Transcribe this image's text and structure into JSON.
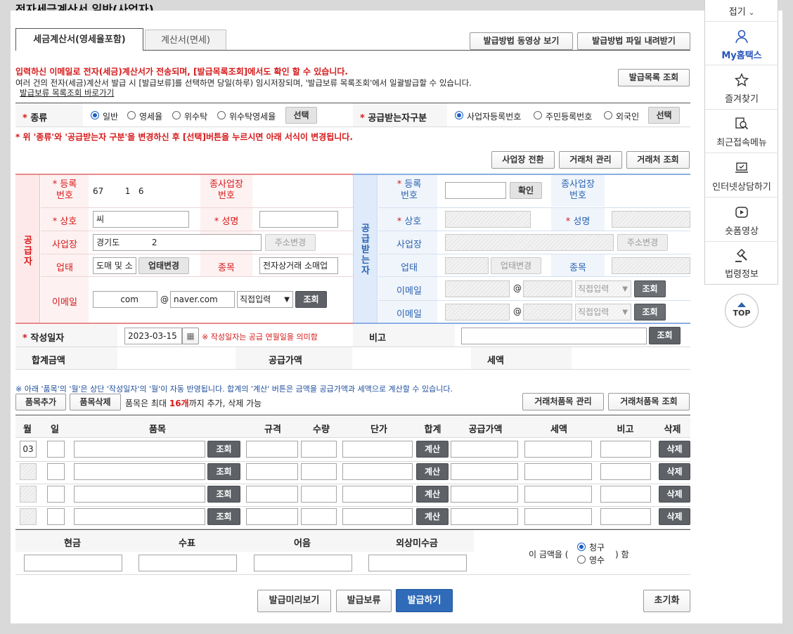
{
  "page": {
    "title": "전자세금계산서 일반(사업자)"
  },
  "tabs": [
    {
      "label": "세금계산서(영세율포함)",
      "active": true
    },
    {
      "label": "계산서(면세)",
      "active": false
    }
  ],
  "top_buttons": {
    "video": "발급방법 동영상 보기",
    "file": "발급방법 파일 내려받기",
    "issue_list": "발급목록 조회"
  },
  "notice": {
    "line1": "입력하신 이메일로 전자(세금)계산서가 전송되며, [발급목록조회]에서도 확인 할 수 있습니다.",
    "line2": "여러 건의 전자(세금)계산서 발급 시 [발급보류]를 선택하면 당일(하루) 임시저장되며, '발급보류 목록조회'에서 일괄발급할 수 있습니다.",
    "hold_link": "발급보류 목록조회 바로가기"
  },
  "type_row": {
    "label": "종류",
    "options": [
      "일반",
      "영세율",
      "위수탁",
      "위수탁영세율"
    ],
    "selected": "일반",
    "select_btn": "선택",
    "recv_label": "공급받는자구분",
    "recv_options": [
      "사업자등록번호",
      "주민등록번호",
      "외국인"
    ],
    "recv_selected": "사업자등록번호",
    "recv_btn": "선택"
  },
  "warn": "* 위 '종류'와 '공급받는자 구분'을 변경하신 후 [선택]버튼을 누르시면 아래 서식이 변경됩니다.",
  "mgmt_buttons": {
    "switch": "사업장 전환",
    "partner_mgmt": "거래처 관리",
    "partner_query": "거래처 조회"
  },
  "supplier": {
    "side": "공급자",
    "reg_label1": "등록",
    "reg_label2": "번호",
    "reg_value": "67        1   6",
    "sub_label1": "종사업장",
    "sub_label2": "번호",
    "name_label": "상호",
    "name_value": "씨",
    "ceo_label": "성명",
    "addr_label": "사업장",
    "addr_value": "경기도            2",
    "addr_btn": "주소변경",
    "biz_label": "업태",
    "biz_value": "도매 및 소",
    "biz_btn": "업태변경",
    "item_label": "종목",
    "item_value": "전자상거래 소매업",
    "email_label": "이메일",
    "email_id": "         com",
    "email_at": "@",
    "email_domain": "naver.com",
    "email_select": "직접입력",
    "email_btn": "조회"
  },
  "buyer": {
    "side": "공급받는자",
    "reg_label1": "등록",
    "reg_label2": "번호",
    "confirm_btn": "확인",
    "sub_label1": "종사업장",
    "sub_label2": "번호",
    "name_label": "상호",
    "ceo_label": "성명",
    "addr_label": "사업장",
    "addr_btn": "주소변경",
    "biz_label": "업태",
    "biz_btn": "업태변경",
    "item_label": "종목",
    "email_label": "이메일",
    "email_at": "@",
    "email_select": "직접입력",
    "email_btn": "조회"
  },
  "date_row": {
    "label": "작성일자",
    "value": "2023-03-15",
    "note": "※ 작성일자는 공급 연월일을 의미함",
    "remark_label": "비고",
    "remark_btn": "조회"
  },
  "totals": {
    "sum_label": "합계금액",
    "supply_label": "공급가액",
    "tax_label": "세액"
  },
  "items_notice": "※ 아래 '품목'의 '월'은 상단 '작성일자'의 '월'이 자동 반영됩니다. 합계의 '계산' 버튼은 금액을 공급가액과 세액으로 계산할 수 있습니다.",
  "item_buttons": {
    "add": "품목추가",
    "del": "품목삭제",
    "limit_pre": "품목은 최대 ",
    "limit_num": "16개",
    "limit_post": "까지 추가, 삭제 가능",
    "partner_items_mgmt": "거래처품목 관리",
    "partner_items_query": "거래처품목 조회"
  },
  "table": {
    "headers": [
      "월",
      "일",
      "품목",
      "규격",
      "수량",
      "단가",
      "합계",
      "공급가액",
      "세액",
      "비고",
      "삭제"
    ],
    "rows": [
      {
        "month": "03"
      },
      {
        "month": ""
      },
      {
        "month": ""
      },
      {
        "month": ""
      }
    ],
    "query_btn": "조회",
    "calc_btn": "계산",
    "delete_btn": "삭제"
  },
  "payment": {
    "headers": [
      "현금",
      "수표",
      "어음",
      "외상미수금"
    ],
    "amount_pre": "이 금액을 (",
    "claim": "청구",
    "receipt": "영수",
    "selected": "청구",
    "amount_post": ") 함"
  },
  "bottom_buttons": {
    "preview": "발급미리보기",
    "hold": "발급보류",
    "issue": "발급하기",
    "reset": "초기화"
  },
  "side_menu": {
    "collapse": "접기",
    "items": [
      {
        "label": "My홈택스",
        "icon": "person-icon"
      },
      {
        "label": "즐겨찾기",
        "icon": "star-icon"
      },
      {
        "label": "최근접속메뉴",
        "icon": "recent-search-icon"
      },
      {
        "label": "인터넷상담하기",
        "icon": "laptop-chat-icon"
      },
      {
        "label": "숏폼영상",
        "icon": "video-play-icon"
      },
      {
        "label": "법령정보",
        "icon": "gavel-icon"
      }
    ],
    "top": "TOP"
  },
  "colors": {
    "accent": "#d6191a",
    "blue": "#2f6bb8",
    "supplier_border": "#e88a8a",
    "buyer_border": "#8aaee0"
  }
}
